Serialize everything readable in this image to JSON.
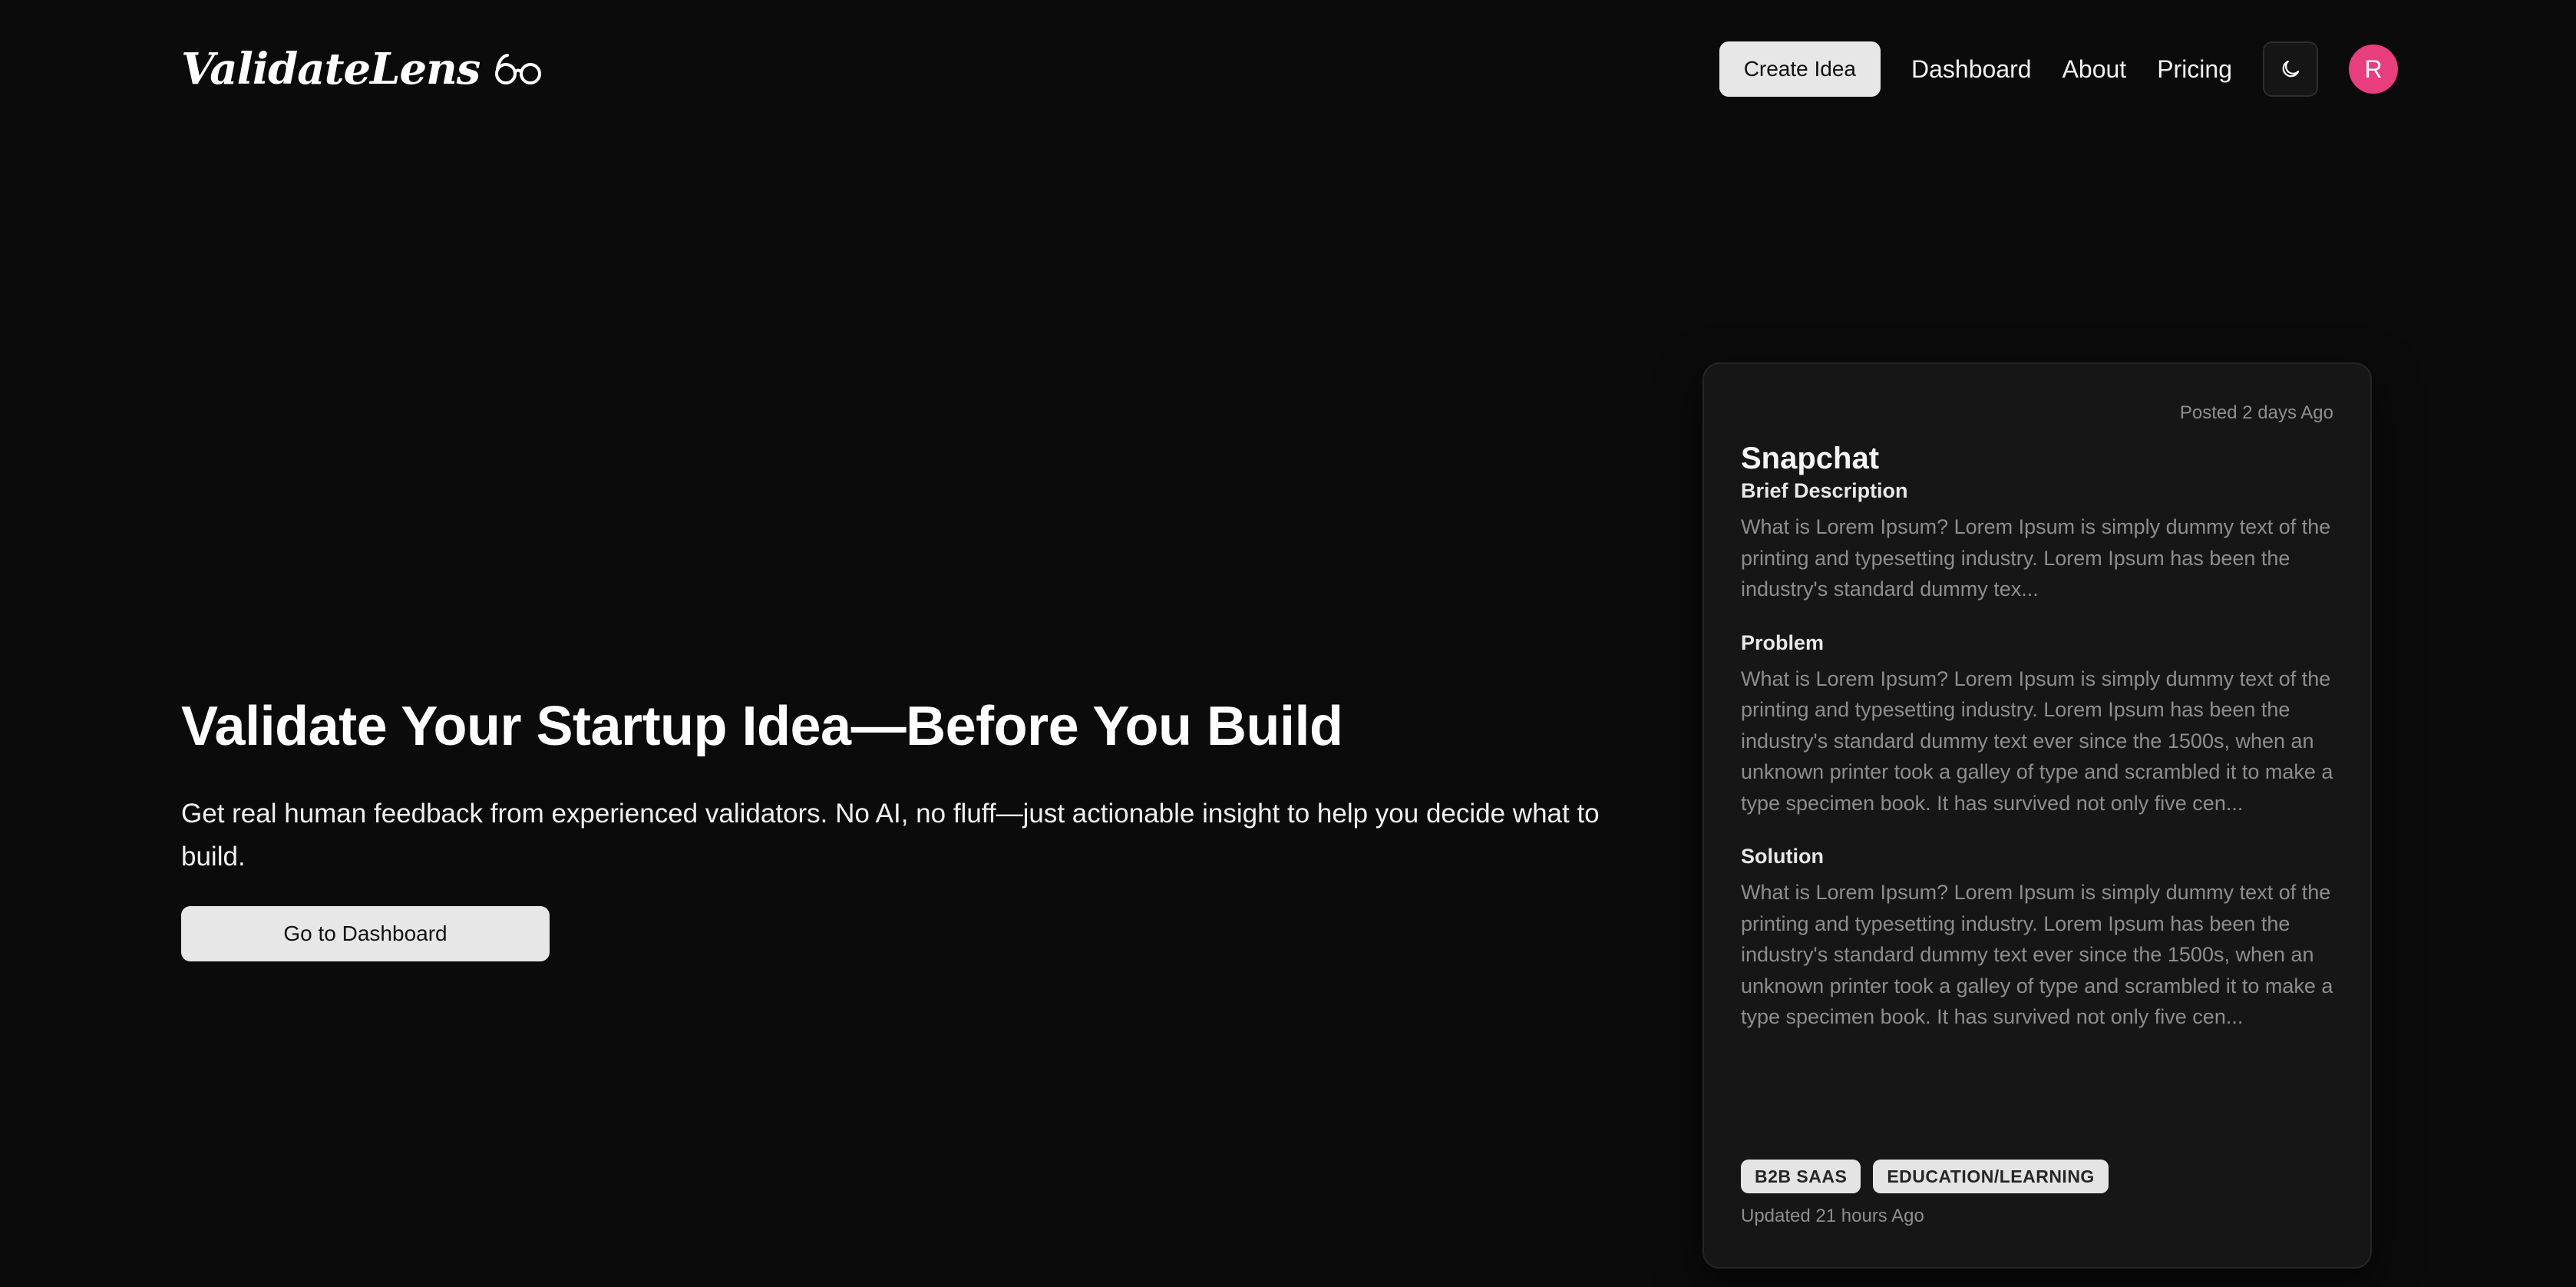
{
  "brand": {
    "name": "ValidateLens",
    "logo_icon": "glasses-icon"
  },
  "nav": {
    "create_label": "Create Idea",
    "links": [
      "Dashboard",
      "About",
      "Pricing"
    ],
    "theme_icon": "moon-icon",
    "avatar_initial": "R",
    "avatar_color": "#e83e7d"
  },
  "hero": {
    "title": "Validate Your Startup Idea—Before You Build",
    "subtitle": "Get real human feedback from experienced validators. No AI, no fluff—just actionable insight to help you decide what to build.",
    "cta_label": "Go to Dashboard"
  },
  "card": {
    "posted": "Posted 2 days Ago",
    "title": "Snapchat",
    "brief_label": "Brief Description",
    "brief_text": "What is Lorem Ipsum? Lorem Ipsum is simply dummy text of the printing and typesetting industry. Lorem Ipsum has been the industry's standard dummy tex...",
    "problem_label": "Problem",
    "problem_text": "What is Lorem Ipsum? Lorem Ipsum is simply dummy text of the printing and typesetting industry. Lorem Ipsum has been the industry's standard dummy text ever since the 1500s, when an unknown printer took a galley of type and scrambled it to make a type specimen book. It has survived not only five cen...",
    "solution_label": "Solution",
    "solution_text": "What is Lorem Ipsum? Lorem Ipsum is simply dummy text of the printing and typesetting industry. Lorem Ipsum has been the industry's standard dummy text ever since the 1500s, when an unknown printer took a galley of type and scrambled it to make a type specimen book. It has survived not only five cen...",
    "tags": [
      "B2B SAAS",
      "EDUCATION/LEARNING"
    ],
    "updated": "Updated 21 hours Ago"
  }
}
